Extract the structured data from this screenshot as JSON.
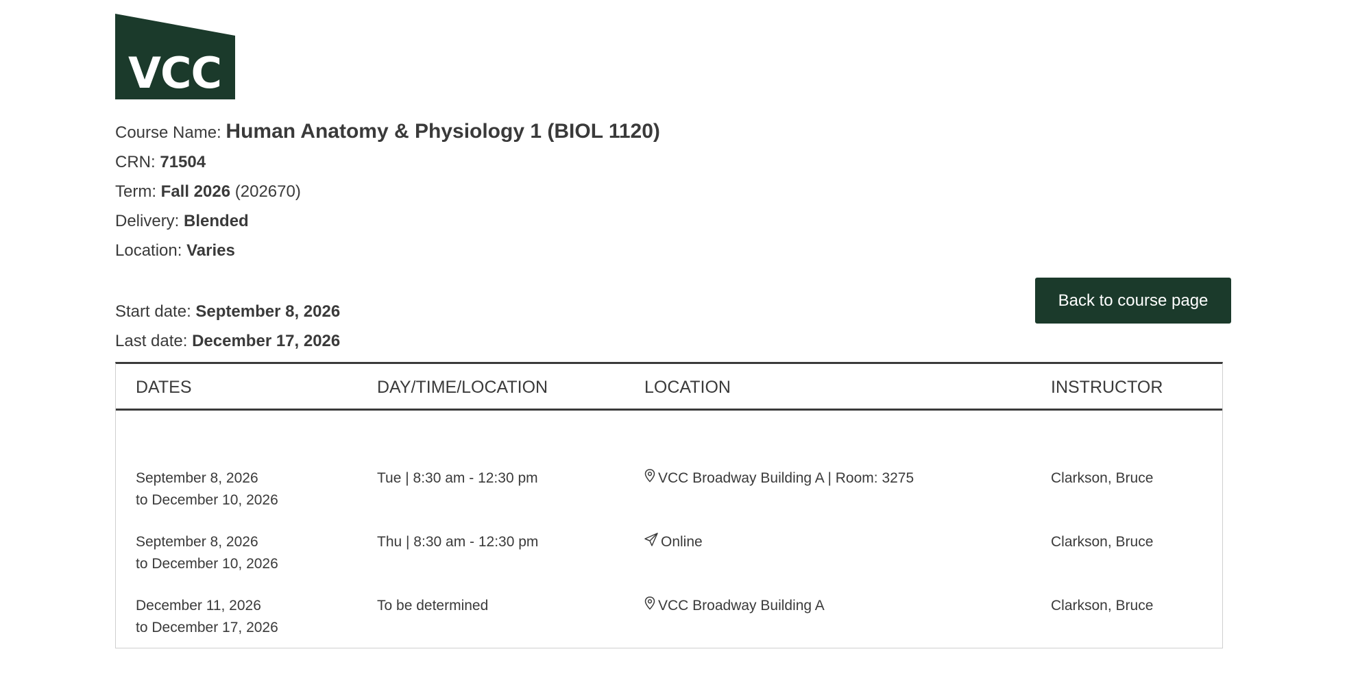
{
  "logo": {
    "text": "VCC",
    "color": "#1b3a2b"
  },
  "course": {
    "name_label": "Course Name:",
    "name_value": "Human Anatomy & Physiology 1 (BIOL 1120)",
    "crn_label": "CRN:",
    "crn_value": "71504",
    "term_label": "Term:",
    "term_value": "Fall 2026",
    "term_code": "(202670)",
    "delivery_label": "Delivery:",
    "delivery_value": "Blended",
    "location_label": "Location:",
    "location_value": "Varies"
  },
  "dates": {
    "start_label": "Start date:",
    "start_value": "September 8, 2026",
    "last_label": "Last date:",
    "last_value": "December 17, 2026"
  },
  "back_button": {
    "label": "Back to course page",
    "color": "#1b3a2b"
  },
  "schedule": {
    "headers": [
      "Dates",
      "Day/Time/Location",
      "Location",
      "Instructor"
    ],
    "rows": [
      {
        "date_start": "September 8, 2026",
        "date_end": "to December 10, 2026",
        "daytime": "Tue | 8:30 am - 12:30 pm",
        "location_icon": "map-pin-icon",
        "location": "VCC Broadway Building A | Room: 3275",
        "instructor": "Clarkson, Bruce"
      },
      {
        "date_start": "September 8, 2026",
        "date_end": "to December 10, 2026",
        "daytime": "Thu | 8:30 am - 12:30 pm",
        "location_icon": "paper-plane-icon",
        "location": "Online",
        "instructor": "Clarkson, Bruce"
      },
      {
        "date_start": "December 11, 2026",
        "date_end": "to December 17, 2026",
        "daytime": "To be determined",
        "location_icon": "map-pin-icon",
        "location": "VCC Broadway Building A",
        "instructor": "Clarkson, Bruce"
      }
    ]
  }
}
